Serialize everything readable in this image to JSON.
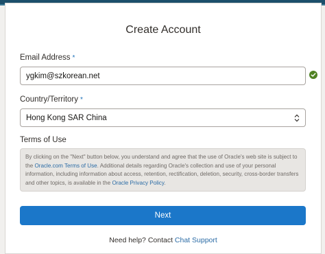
{
  "form": {
    "title": "Create Account",
    "email_label": "Email Address",
    "required_mark": "*",
    "email_value": "ygkim@szkorean.net",
    "country_label": "Country/Territory",
    "country_value": "Hong Kong SAR China",
    "terms_label": "Terms of Use",
    "terms_text_1": "By clicking on the \"Next\" button below, you understand and agree that the use of Oracle's web site is subject to the ",
    "terms_link_1": "Oracle.com Terms of Use",
    "terms_text_2": ". Additional details regarding Oracle's collection and use of your personal information, including information about access, retention, rectification, deletion, security, cross-border transfers and other topics, is available in the ",
    "terms_link_2": "Oracle Privacy Policy",
    "terms_text_3": ".",
    "next_label": "Next",
    "help_text": "Need help? Contact ",
    "help_link": "Chat Support"
  },
  "icons": {
    "email_valid": "check-circle-icon",
    "select_arrows": "updown-arrows-icon"
  },
  "colors": {
    "primary": "#1b77c9",
    "link": "#2a6ba5",
    "valid": "#508223",
    "band": "#1c4f6b"
  }
}
